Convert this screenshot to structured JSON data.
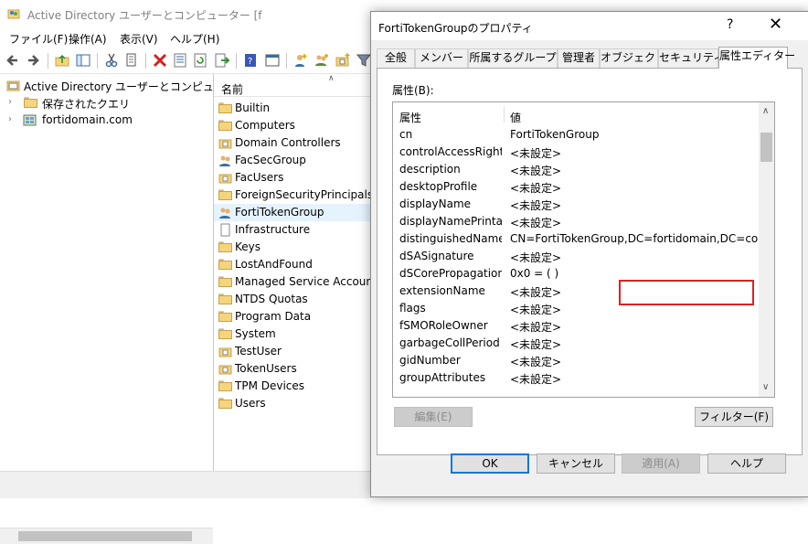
{
  "main": {
    "title": "Active Directory ユーザーとコンピューター [f",
    "menu": [
      "ファイル(F)",
      "操作(A)",
      "表示(V)",
      "ヘルプ(H)"
    ]
  },
  "tree": {
    "root": "Active Directory ユーザーとコンピューター [f",
    "items": [
      "保存されたクエリ",
      "fortidomain.com"
    ]
  },
  "list": {
    "header": "名前",
    "items": [
      {
        "label": "Builtin",
        "icon": "folder-icon"
      },
      {
        "label": "Computers",
        "icon": "folder-icon"
      },
      {
        "label": "Domain Controllers",
        "icon": "ou-folder-icon"
      },
      {
        "label": "FacSecGroup",
        "icon": "group-icon"
      },
      {
        "label": "FacUsers",
        "icon": "ou-folder-icon"
      },
      {
        "label": "ForeignSecurityPrincipals",
        "icon": "folder-icon"
      },
      {
        "label": "FortiTokenGroup",
        "icon": "group-icon"
      },
      {
        "label": "Infrastructure",
        "icon": "document-icon"
      },
      {
        "label": "Keys",
        "icon": "folder-icon"
      },
      {
        "label": "LostAndFound",
        "icon": "folder-icon"
      },
      {
        "label": "Managed Service Accounts",
        "icon": "folder-icon"
      },
      {
        "label": "NTDS Quotas",
        "icon": "folder-icon"
      },
      {
        "label": "Program Data",
        "icon": "folder-icon"
      },
      {
        "label": "System",
        "icon": "folder-icon"
      },
      {
        "label": "TestUser",
        "icon": "ou-folder-icon"
      },
      {
        "label": "TokenUsers",
        "icon": "ou-folder-icon"
      },
      {
        "label": "TPM Devices",
        "icon": "folder-icon"
      },
      {
        "label": "Users",
        "icon": "folder-icon"
      }
    ]
  },
  "dialog": {
    "title": "FortiTokenGroupのプロパティ",
    "help": "?",
    "close": "✕",
    "tabs": [
      "全般",
      "メンバー",
      "所属するグループ",
      "管理者",
      "オブジェクト",
      "セキュリティ",
      "属性エディター"
    ],
    "attributes_label": "属性(B):",
    "col_attr": "属性",
    "col_value": "値",
    "rows": [
      {
        "name": "cn",
        "value": "FortiTokenGroup"
      },
      {
        "name": "controlAccessRights",
        "value": "<未設定>"
      },
      {
        "name": "description",
        "value": "<未設定>"
      },
      {
        "name": "desktopProfile",
        "value": "<未設定>"
      },
      {
        "name": "displayName",
        "value": "<未設定>"
      },
      {
        "name": "displayNamePrinta...",
        "value": "<未設定>"
      },
      {
        "name": "distinguishedName",
        "value": "CN=FortiTokenGroup,DC=fortidomain,DC=com"
      },
      {
        "name": "dSASignature",
        "value": "<未設定>"
      },
      {
        "name": "dSCorePropagation...",
        "value": "0x0 = ( )"
      },
      {
        "name": "extensionName",
        "value": "<未設定>"
      },
      {
        "name": "flags",
        "value": "<未設定>"
      },
      {
        "name": "fSMORoleOwner",
        "value": "<未設定>"
      },
      {
        "name": "garbageCollPeriod",
        "value": "<未設定>"
      },
      {
        "name": "gidNumber",
        "value": "<未設定>"
      },
      {
        "name": "groupAttributes",
        "value": "<未設定>"
      }
    ],
    "edit_button": "編集(E)",
    "filter_button": "フィルター(F)",
    "ok_button": "OK",
    "cancel_button": "キャンセル",
    "apply_button": "適用(A)",
    "help_button": "ヘルプ"
  },
  "colors": {
    "highlight": "#e02020",
    "selection": "#e5f3ff",
    "accent": "#0078d7"
  }
}
